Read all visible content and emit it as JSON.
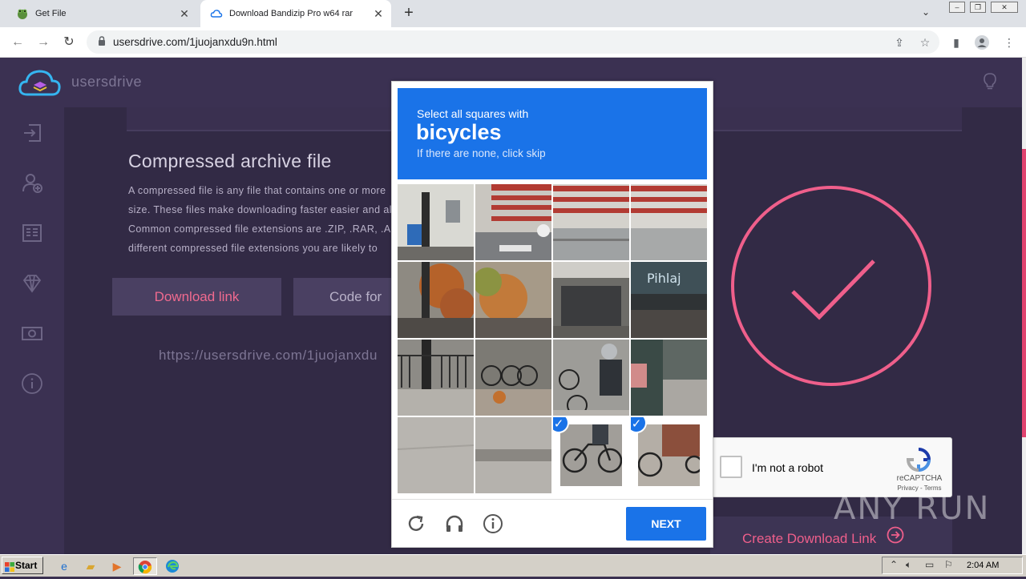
{
  "browser": {
    "tabs": [
      {
        "title": "Get File",
        "icon": "frog-icon"
      },
      {
        "title": "Download Bandizip Pro w64 rar",
        "icon": "cloud-icon"
      }
    ],
    "url": "usersdrive.com/1juojanxdu9n.html"
  },
  "site": {
    "brand": "usersdrive",
    "article": {
      "title": "Compressed archive file",
      "lines": [
        "A compressed file is any file that contains one or more",
        "size. These files make downloading faster easier and al",
        "Common compressed file extensions are .ZIP, .RAR, .AR",
        "different compressed file extensions you are likely to"
      ]
    },
    "buttons": {
      "download_link": "Download link",
      "code_for": "Code for"
    },
    "download_url": "https://usersdrive.com/1juojanxdu",
    "create_link": "Create Download Link"
  },
  "recaptcha": {
    "anchor_label": "I'm not a robot",
    "brand": "reCAPTCHA",
    "terms": "Privacy - Terms",
    "challenge": {
      "line1": "Select all squares with",
      "target": "bicycles",
      "line3": "If there are none, click skip",
      "next_label": "NEXT",
      "selected_tiles": [
        14,
        15
      ]
    }
  },
  "watermark": "ANY RUN",
  "taskbar": {
    "start_label": "Start",
    "clock": "2:04 AM"
  },
  "colors": {
    "accent_pink": "#ef5f8b",
    "recaptcha_blue": "#1a73e8",
    "site_bg": "#3a3050"
  }
}
